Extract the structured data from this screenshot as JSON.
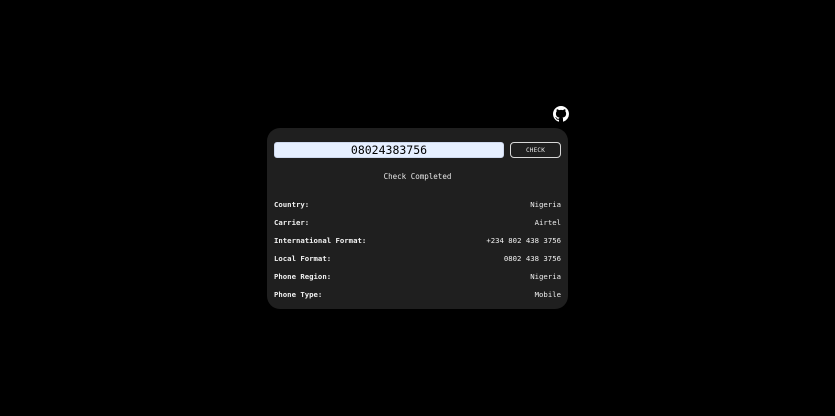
{
  "header": {
    "github_icon": "github-icon"
  },
  "form": {
    "phone_value": "08024383756",
    "check_label": "CHECK"
  },
  "status": {
    "text": "Check Completed"
  },
  "results": [
    {
      "label": "Country:",
      "value": "Nigeria"
    },
    {
      "label": "Carrier:",
      "value": "Airtel"
    },
    {
      "label": "International Format:",
      "value": "+234 802 438 3756"
    },
    {
      "label": "Local Format:",
      "value": "0802 438 3756"
    },
    {
      "label": "Phone Region:",
      "value": "Nigeria"
    },
    {
      "label": "Phone Type:",
      "value": "Mobile"
    }
  ],
  "colors": {
    "background": "#000000",
    "card": "#1f1f1f",
    "input_bg": "#e6efff",
    "text": "#f0f0f0"
  }
}
